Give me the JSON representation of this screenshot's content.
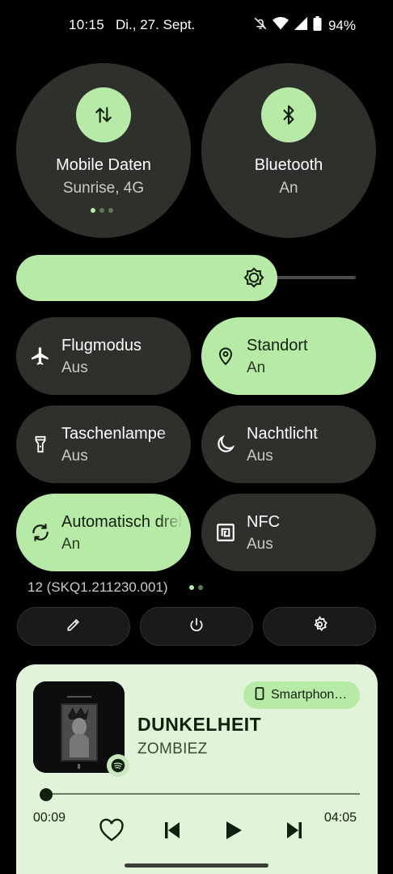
{
  "status_bar": {
    "time": "10:15",
    "date": "Di., 27. Sept.",
    "battery": "94%"
  },
  "big_tiles": [
    {
      "title": "Mobile Daten",
      "subtitle": "Sunrise, 4G",
      "icon": "data-transfer-icon"
    },
    {
      "title": "Bluetooth",
      "subtitle": "An",
      "icon": "bluetooth-icon"
    }
  ],
  "brightness": {
    "level": 0.73
  },
  "tiles": [
    {
      "title": "Flugmodus",
      "subtitle": "Aus",
      "icon": "airplane-icon",
      "active": false
    },
    {
      "title": "Standort",
      "subtitle": "An",
      "icon": "location-icon",
      "active": true
    },
    {
      "title": "Taschenlampe",
      "subtitle": "Aus",
      "icon": "flashlight-icon",
      "active": false
    },
    {
      "title": "Nachtlicht",
      "subtitle": "Aus",
      "icon": "moon-icon",
      "active": false
    },
    {
      "title": "Automatisch drehen",
      "subtitle": "An",
      "icon": "auto-rotate-icon",
      "active": true
    },
    {
      "title": "NFC",
      "subtitle": "Aus",
      "icon": "nfc-icon",
      "active": false
    }
  ],
  "build": {
    "text": "12 (SKQ1.211230.001)"
  },
  "media": {
    "output_device": "Smartphon…",
    "title": "DUNKELHEIT",
    "artist": "ZOMBIEZ",
    "elapsed": "00:09",
    "total": "04:05",
    "progress": 0.037
  },
  "colors": {
    "accent": "#b7eaa6",
    "tile_bg": "#2e302b",
    "media_bg": "#e1f4d9"
  }
}
